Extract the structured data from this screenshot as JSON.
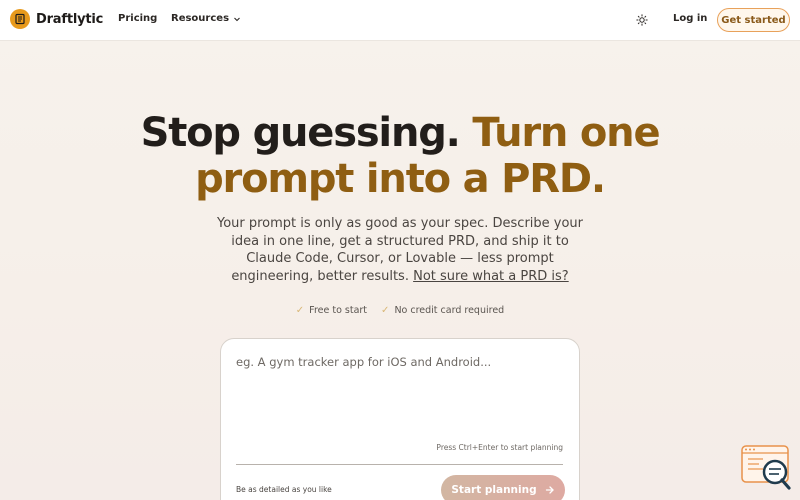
{
  "header": {
    "brand": "Draftlytic",
    "nav": [
      {
        "label": "Pricing"
      },
      {
        "label": "Resources"
      }
    ],
    "login_label": "Log in",
    "cta_label": "Get started"
  },
  "hero": {
    "title_part1": "Stop guessing.",
    "title_part2": "Turn one prompt into a PRD.",
    "subtitle": "Your prompt is only as good as your spec. Describe your idea in one line, get a structured PRD, and ship it to Claude Code, Cursor, or Lovable — less prompt engineering, better results.",
    "subtitle_link": "Not sure what a PRD is?"
  },
  "perks": [
    "Free to start",
    "No credit card required"
  ],
  "prompt_card": {
    "placeholder": "eg. A gym tracker app for iOS and Android...",
    "shortcut_hint": "Press Ctrl+Enter to start planning",
    "detail_note": "Be as detailed as you like",
    "submit_label": "Start planning"
  },
  "colors": {
    "accent": "#8f5e12",
    "logo": "#e89a1c",
    "cta_border": "#e8a15a"
  },
  "icons": {
    "theme": "sun-icon",
    "helper": "chat-search-icon"
  }
}
